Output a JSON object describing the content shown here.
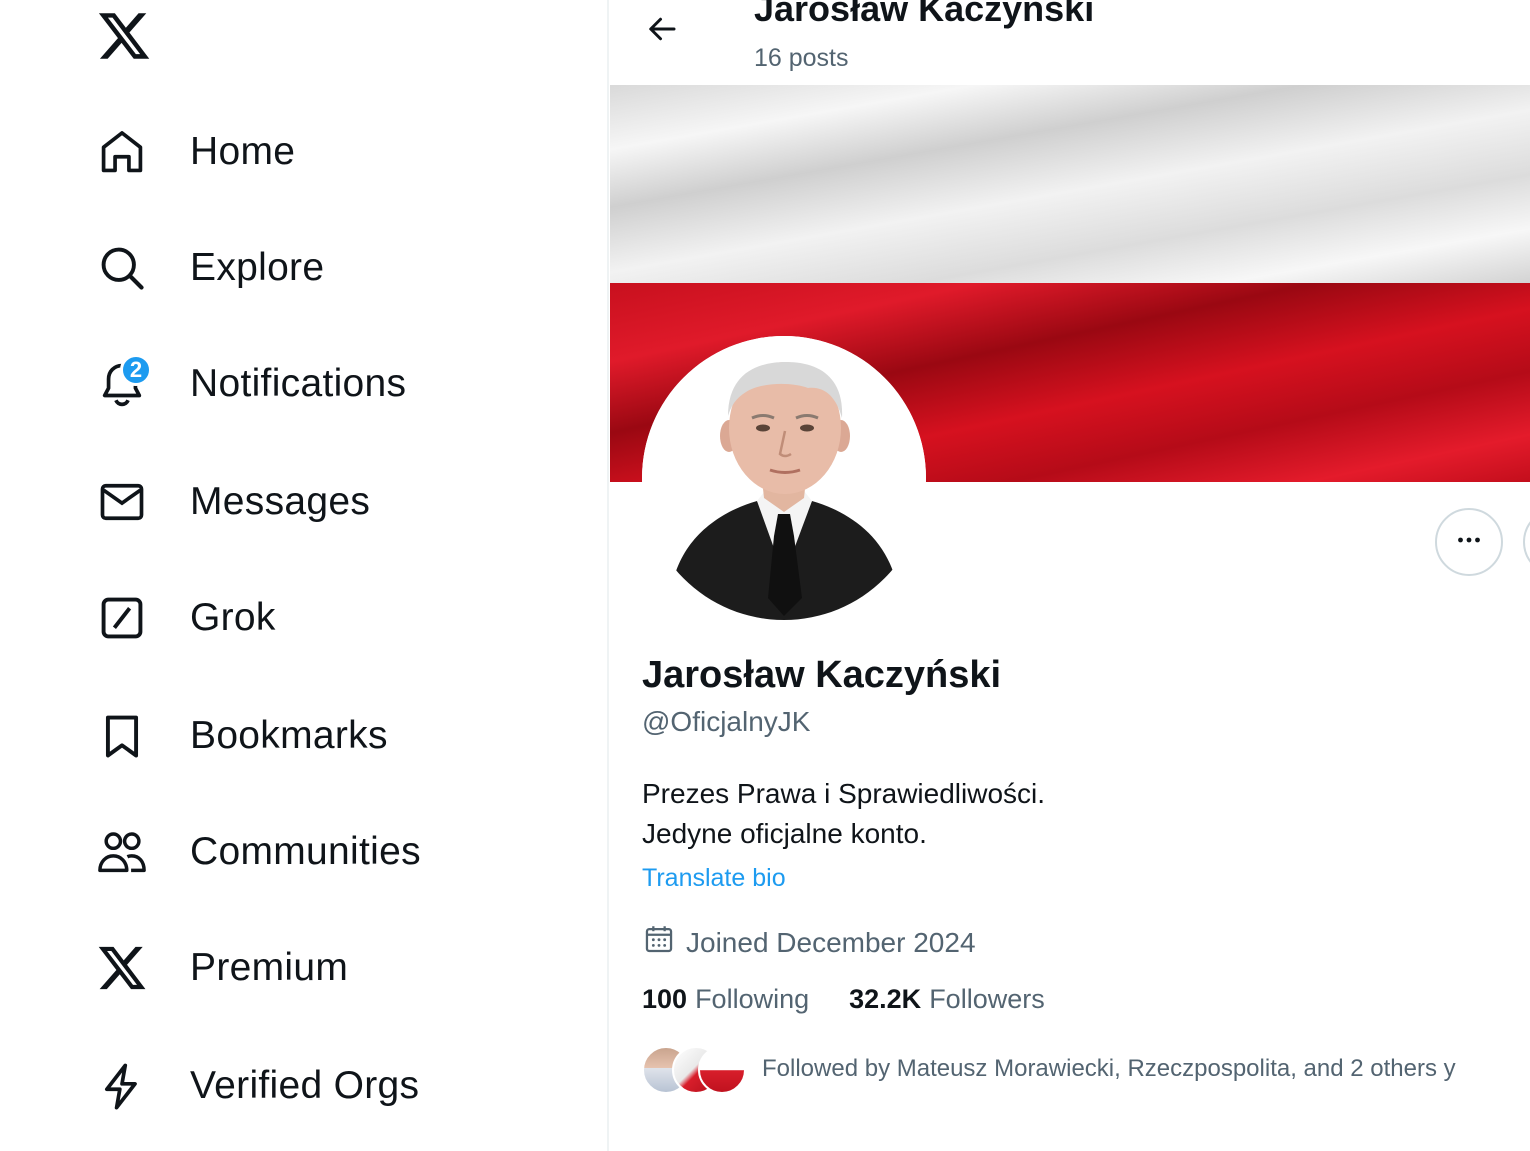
{
  "nav": {
    "items": [
      {
        "label": "Home",
        "icon": "home-icon"
      },
      {
        "label": "Explore",
        "icon": "search-icon"
      },
      {
        "label": "Notifications",
        "icon": "bell-icon",
        "badge": "2"
      },
      {
        "label": "Messages",
        "icon": "envelope-icon"
      },
      {
        "label": "Grok",
        "icon": "grok-icon"
      },
      {
        "label": "Bookmarks",
        "icon": "bookmark-icon"
      },
      {
        "label": "Communities",
        "icon": "people-icon"
      },
      {
        "label": "Premium",
        "icon": "x-logo-icon"
      },
      {
        "label": "Verified Orgs",
        "icon": "lightning-icon"
      }
    ]
  },
  "header": {
    "name": "Jarosław Kaczyński",
    "posts": "16 posts"
  },
  "profile": {
    "name": "Jarosław Kaczyński",
    "handle": "@OficjalnyJK",
    "bio": [
      "Prezes Prawa i Sprawiedliwości.",
      "Jedyne oficjalne konto."
    ],
    "translate_label": "Translate bio",
    "joined": "Joined December 2024",
    "following_count": "100",
    "following_label": "Following",
    "followers_count": "32.2K",
    "followers_label": "Followers",
    "followed_by": "Followed by Mateusz Morawiecki, Rzeczpospolita, and 2 others y"
  },
  "colors": {
    "accent": "#1d9bf0",
    "secondary_text": "#536471",
    "flag_red": "#d6111f"
  }
}
